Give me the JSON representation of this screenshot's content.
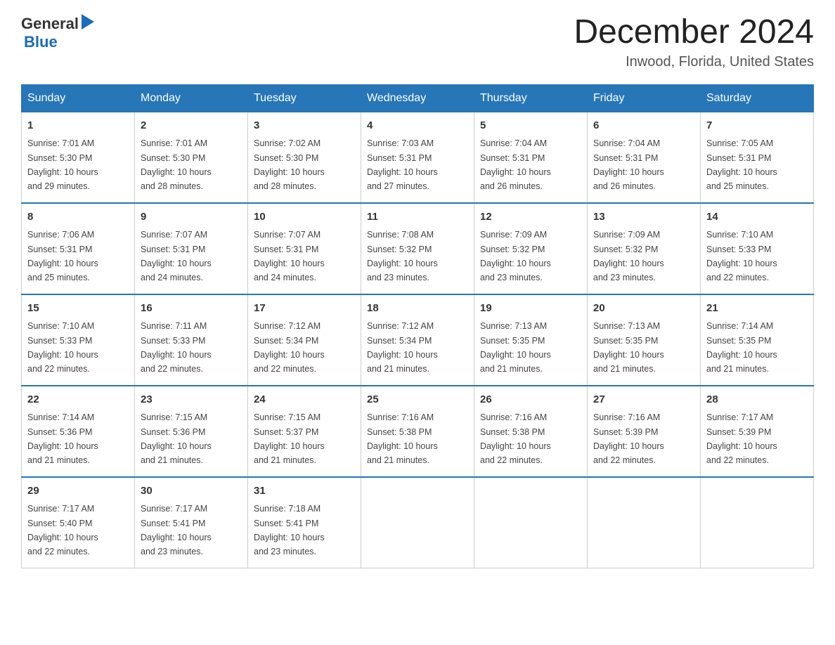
{
  "header": {
    "logo_general": "General",
    "logo_blue": "Blue",
    "title": "December 2024",
    "subtitle": "Inwood, Florida, United States"
  },
  "days_of_week": [
    "Sunday",
    "Monday",
    "Tuesday",
    "Wednesday",
    "Thursday",
    "Friday",
    "Saturday"
  ],
  "weeks": [
    [
      {
        "day": "1",
        "sunrise": "7:01 AM",
        "sunset": "5:30 PM",
        "daylight": "10 hours and 29 minutes."
      },
      {
        "day": "2",
        "sunrise": "7:01 AM",
        "sunset": "5:30 PM",
        "daylight": "10 hours and 28 minutes."
      },
      {
        "day": "3",
        "sunrise": "7:02 AM",
        "sunset": "5:30 PM",
        "daylight": "10 hours and 28 minutes."
      },
      {
        "day": "4",
        "sunrise": "7:03 AM",
        "sunset": "5:31 PM",
        "daylight": "10 hours and 27 minutes."
      },
      {
        "day": "5",
        "sunrise": "7:04 AM",
        "sunset": "5:31 PM",
        "daylight": "10 hours and 26 minutes."
      },
      {
        "day": "6",
        "sunrise": "7:04 AM",
        "sunset": "5:31 PM",
        "daylight": "10 hours and 26 minutes."
      },
      {
        "day": "7",
        "sunrise": "7:05 AM",
        "sunset": "5:31 PM",
        "daylight": "10 hours and 25 minutes."
      }
    ],
    [
      {
        "day": "8",
        "sunrise": "7:06 AM",
        "sunset": "5:31 PM",
        "daylight": "10 hours and 25 minutes."
      },
      {
        "day": "9",
        "sunrise": "7:07 AM",
        "sunset": "5:31 PM",
        "daylight": "10 hours and 24 minutes."
      },
      {
        "day": "10",
        "sunrise": "7:07 AM",
        "sunset": "5:31 PM",
        "daylight": "10 hours and 24 minutes."
      },
      {
        "day": "11",
        "sunrise": "7:08 AM",
        "sunset": "5:32 PM",
        "daylight": "10 hours and 23 minutes."
      },
      {
        "day": "12",
        "sunrise": "7:09 AM",
        "sunset": "5:32 PM",
        "daylight": "10 hours and 23 minutes."
      },
      {
        "day": "13",
        "sunrise": "7:09 AM",
        "sunset": "5:32 PM",
        "daylight": "10 hours and 23 minutes."
      },
      {
        "day": "14",
        "sunrise": "7:10 AM",
        "sunset": "5:33 PM",
        "daylight": "10 hours and 22 minutes."
      }
    ],
    [
      {
        "day": "15",
        "sunrise": "7:10 AM",
        "sunset": "5:33 PM",
        "daylight": "10 hours and 22 minutes."
      },
      {
        "day": "16",
        "sunrise": "7:11 AM",
        "sunset": "5:33 PM",
        "daylight": "10 hours and 22 minutes."
      },
      {
        "day": "17",
        "sunrise": "7:12 AM",
        "sunset": "5:34 PM",
        "daylight": "10 hours and 22 minutes."
      },
      {
        "day": "18",
        "sunrise": "7:12 AM",
        "sunset": "5:34 PM",
        "daylight": "10 hours and 21 minutes."
      },
      {
        "day": "19",
        "sunrise": "7:13 AM",
        "sunset": "5:35 PM",
        "daylight": "10 hours and 21 minutes."
      },
      {
        "day": "20",
        "sunrise": "7:13 AM",
        "sunset": "5:35 PM",
        "daylight": "10 hours and 21 minutes."
      },
      {
        "day": "21",
        "sunrise": "7:14 AM",
        "sunset": "5:35 PM",
        "daylight": "10 hours and 21 minutes."
      }
    ],
    [
      {
        "day": "22",
        "sunrise": "7:14 AM",
        "sunset": "5:36 PM",
        "daylight": "10 hours and 21 minutes."
      },
      {
        "day": "23",
        "sunrise": "7:15 AM",
        "sunset": "5:36 PM",
        "daylight": "10 hours and 21 minutes."
      },
      {
        "day": "24",
        "sunrise": "7:15 AM",
        "sunset": "5:37 PM",
        "daylight": "10 hours and 21 minutes."
      },
      {
        "day": "25",
        "sunrise": "7:16 AM",
        "sunset": "5:38 PM",
        "daylight": "10 hours and 21 minutes."
      },
      {
        "day": "26",
        "sunrise": "7:16 AM",
        "sunset": "5:38 PM",
        "daylight": "10 hours and 22 minutes."
      },
      {
        "day": "27",
        "sunrise": "7:16 AM",
        "sunset": "5:39 PM",
        "daylight": "10 hours and 22 minutes."
      },
      {
        "day": "28",
        "sunrise": "7:17 AM",
        "sunset": "5:39 PM",
        "daylight": "10 hours and 22 minutes."
      }
    ],
    [
      {
        "day": "29",
        "sunrise": "7:17 AM",
        "sunset": "5:40 PM",
        "daylight": "10 hours and 22 minutes."
      },
      {
        "day": "30",
        "sunrise": "7:17 AM",
        "sunset": "5:41 PM",
        "daylight": "10 hours and 23 minutes."
      },
      {
        "day": "31",
        "sunrise": "7:18 AM",
        "sunset": "5:41 PM",
        "daylight": "10 hours and 23 minutes."
      },
      null,
      null,
      null,
      null
    ]
  ],
  "labels": {
    "sunrise": "Sunrise:",
    "sunset": "Sunset:",
    "daylight": "Daylight:"
  }
}
